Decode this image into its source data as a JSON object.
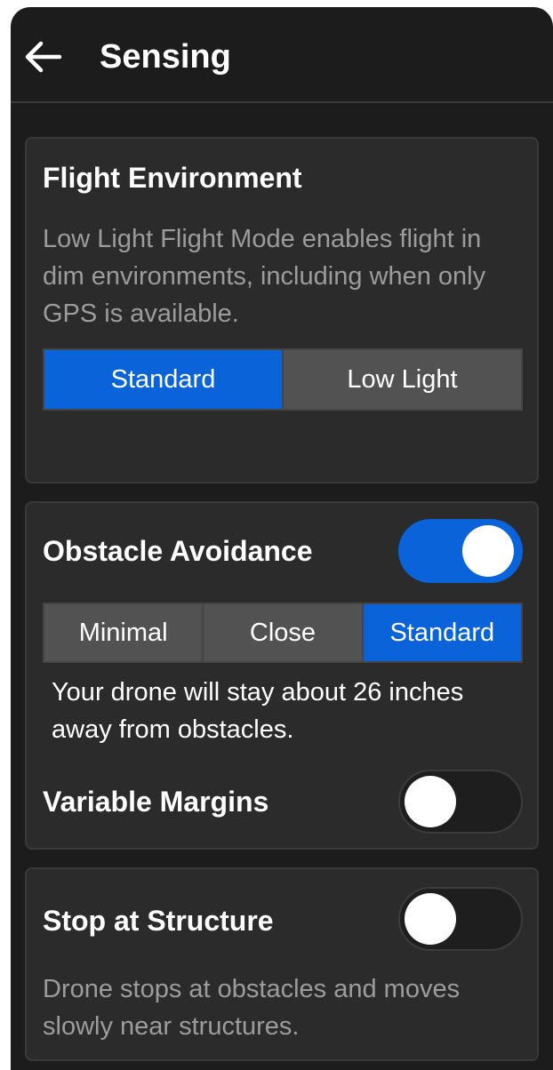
{
  "header": {
    "title": "Sensing"
  },
  "flight_environment": {
    "title": "Flight Environment",
    "description": "Low Light Flight Mode enables flight in dim environments, including when only GPS is available.",
    "options": [
      "Standard",
      "Low Light"
    ],
    "selected": "Standard"
  },
  "obstacle_avoidance": {
    "title": "Obstacle Avoidance",
    "enabled": true,
    "options": [
      "Minimal",
      "Close",
      "Standard"
    ],
    "selected": "Standard",
    "description": "Your drone will stay about 26 inches away from obstacles.",
    "variable_margins": {
      "label": "Variable Margins",
      "enabled": false
    }
  },
  "stop_at_structure": {
    "title": "Stop at Structure",
    "enabled": false,
    "description": "Drone stops at obstacles and moves slowly near structures."
  },
  "colors": {
    "accent": "#0a63d8",
    "background": "#1c1c1c",
    "card": "#2b2b2b"
  }
}
